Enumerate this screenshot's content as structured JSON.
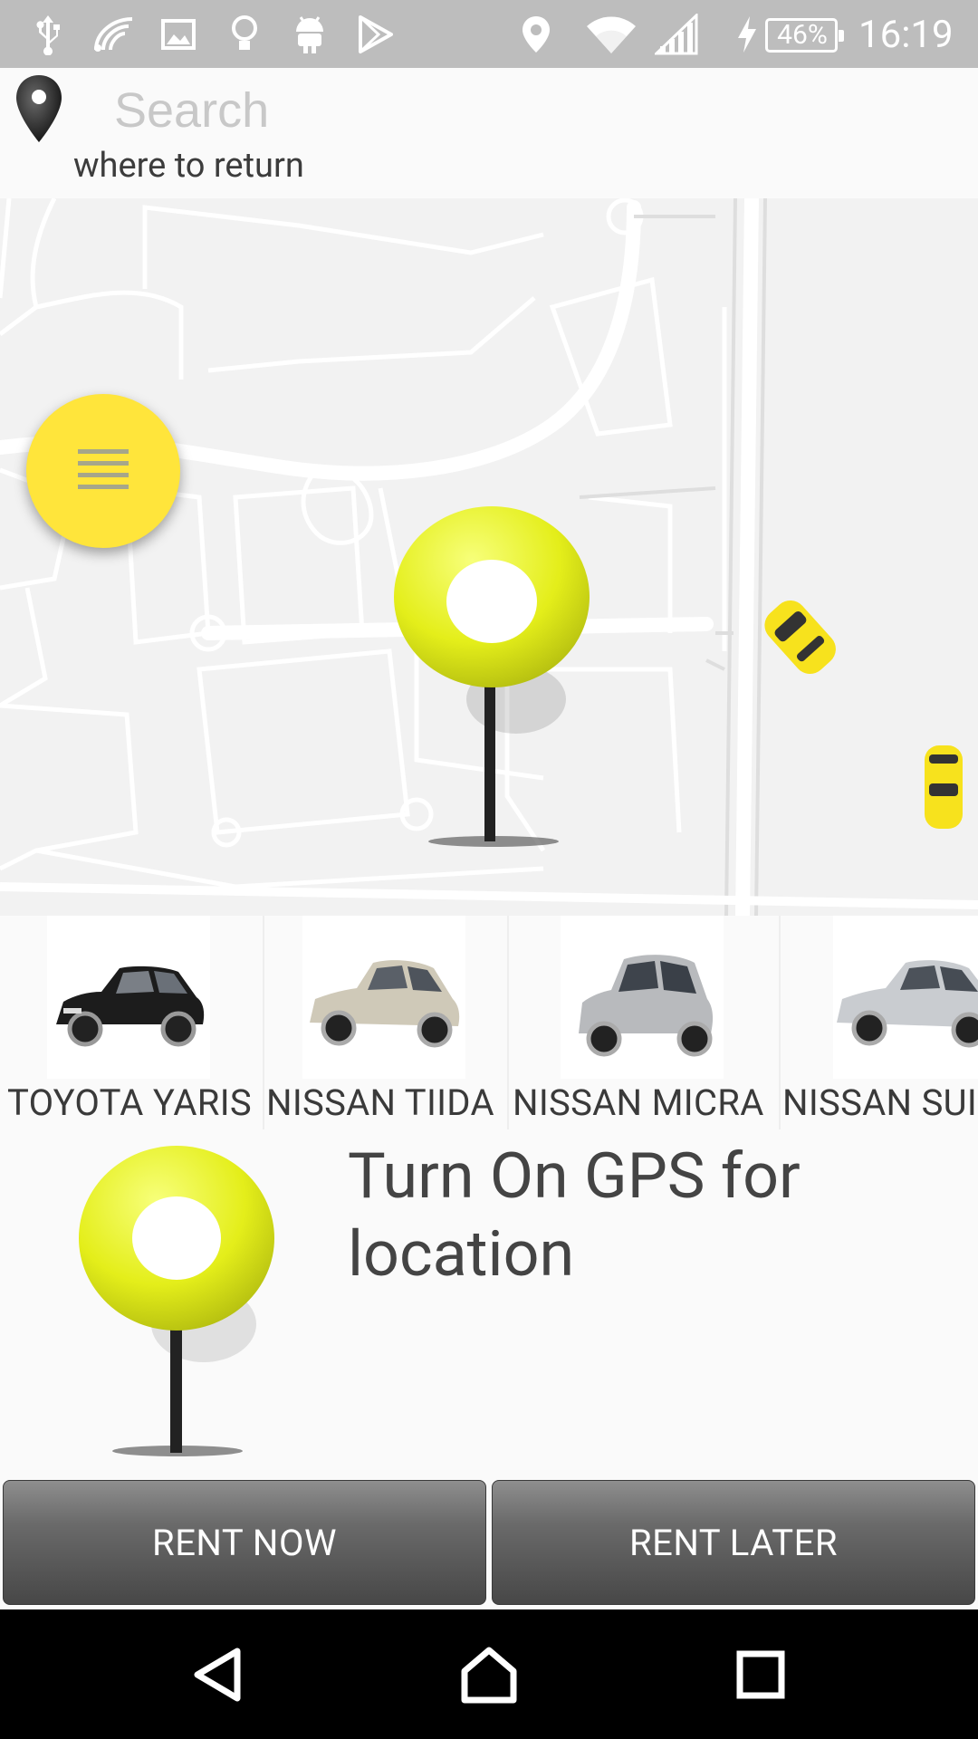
{
  "status_bar": {
    "battery": "46%",
    "time": "16:19",
    "icons": [
      "usb-icon",
      "wifi-calling-icon",
      "image-icon",
      "bulb-icon",
      "android-icon",
      "play-store-icon",
      "location-icon",
      "wifi-icon",
      "signal-icon",
      "charging-icon"
    ]
  },
  "search": {
    "placeholder": "Search",
    "value": "",
    "sublabel": "where to return"
  },
  "map": {
    "menu_icon": "menu-icon",
    "center_pin_icon": "location-pin-icon",
    "taxi_icon": "taxi-car-icon"
  },
  "cars": [
    {
      "name": "TOYOTA YARIS",
      "color": "#1c1c1c"
    },
    {
      "name": "NISSAN TIIDA",
      "color": "#cfc9b8"
    },
    {
      "name": "NISSAN MICRA",
      "color": "#b8babd"
    },
    {
      "name": "NISSAN SUI",
      "color": "#c9ccd0"
    }
  ],
  "gps": {
    "message": "Turn On GPS for location"
  },
  "actions": {
    "rent_now": "RENT NOW",
    "rent_later": "RENT LATER"
  },
  "nav": {
    "back": "back-icon",
    "home": "home-icon",
    "recents": "recents-icon"
  },
  "colors": {
    "accent_yellow": "#ffe53b",
    "pin_yellow": "#e8f01c",
    "status_bar": "#bdbdbd",
    "button_dark": "#474747"
  }
}
